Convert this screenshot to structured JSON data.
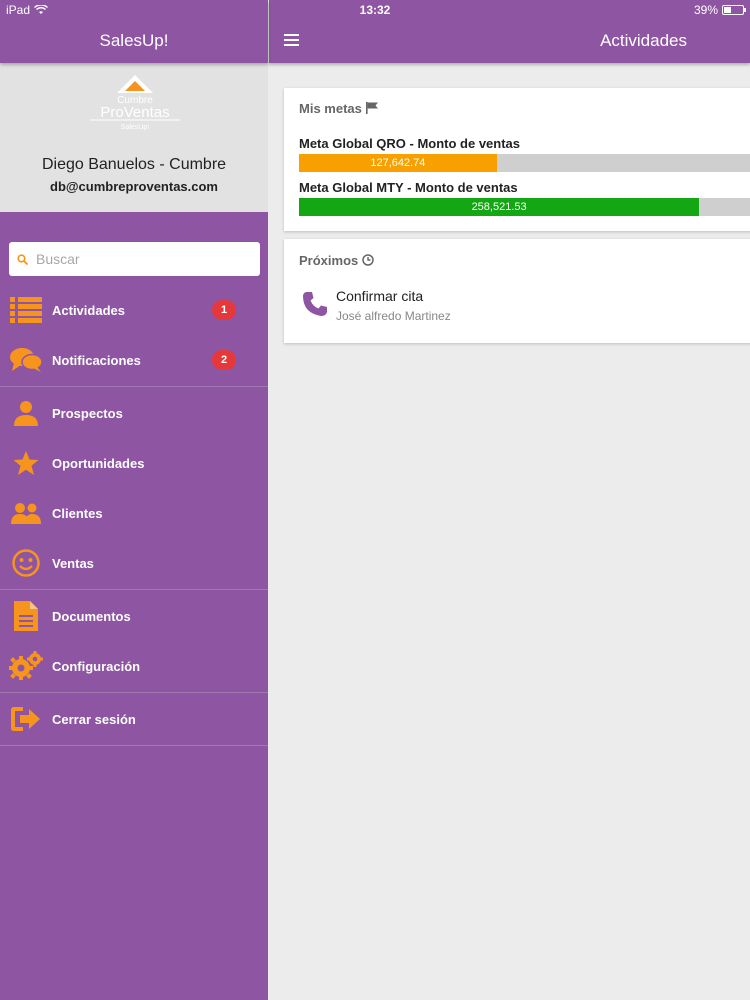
{
  "status_bar": {
    "device": "iPad",
    "time": "13:32",
    "battery": "39%",
    "battery_level": 0.39
  },
  "sidebar": {
    "app_title": "SalesUp!",
    "logo": {
      "line1": "Cumbre",
      "line2": "ProVentas",
      "line3": "SalesUp!"
    },
    "user_name": "Diego Banuelos - Cumbre",
    "user_email": "db@cumbreproventas.com",
    "search_placeholder": "Buscar",
    "accent_color": "#f7941d",
    "menu": [
      {
        "label": "Actividades",
        "icon": "list-icon",
        "badge": "1"
      },
      {
        "label": "Notificaciones",
        "icon": "chat-bubbles-icon",
        "badge": "2"
      },
      {
        "label": "Prospectos",
        "icon": "person-icon"
      },
      {
        "label": "Oportunidades",
        "icon": "star-icon"
      },
      {
        "label": "Clientes",
        "icon": "people-icon"
      },
      {
        "label": "Ventas",
        "icon": "smiley-icon"
      },
      {
        "label": "Documentos",
        "icon": "document-icon"
      },
      {
        "label": "Configuración",
        "icon": "gears-icon"
      },
      {
        "label": "Cerrar sesión",
        "icon": "logout-icon"
      }
    ]
  },
  "main": {
    "title": "Actividades",
    "goals": {
      "heading": "Mis metas",
      "items": [
        {
          "label": "Meta Global QRO - Monto de ventas",
          "value": "127,642.74",
          "fraction": 0.43,
          "color": "#f7a000"
        },
        {
          "label": "Meta Global MTY - Monto de ventas",
          "value": "258,521.53",
          "fraction": 0.87,
          "color": "#13a813"
        }
      ]
    },
    "upcoming": {
      "heading": "Próximos",
      "event_title": "Confirmar cita",
      "event_contact": "José alfredo Martinez"
    }
  }
}
